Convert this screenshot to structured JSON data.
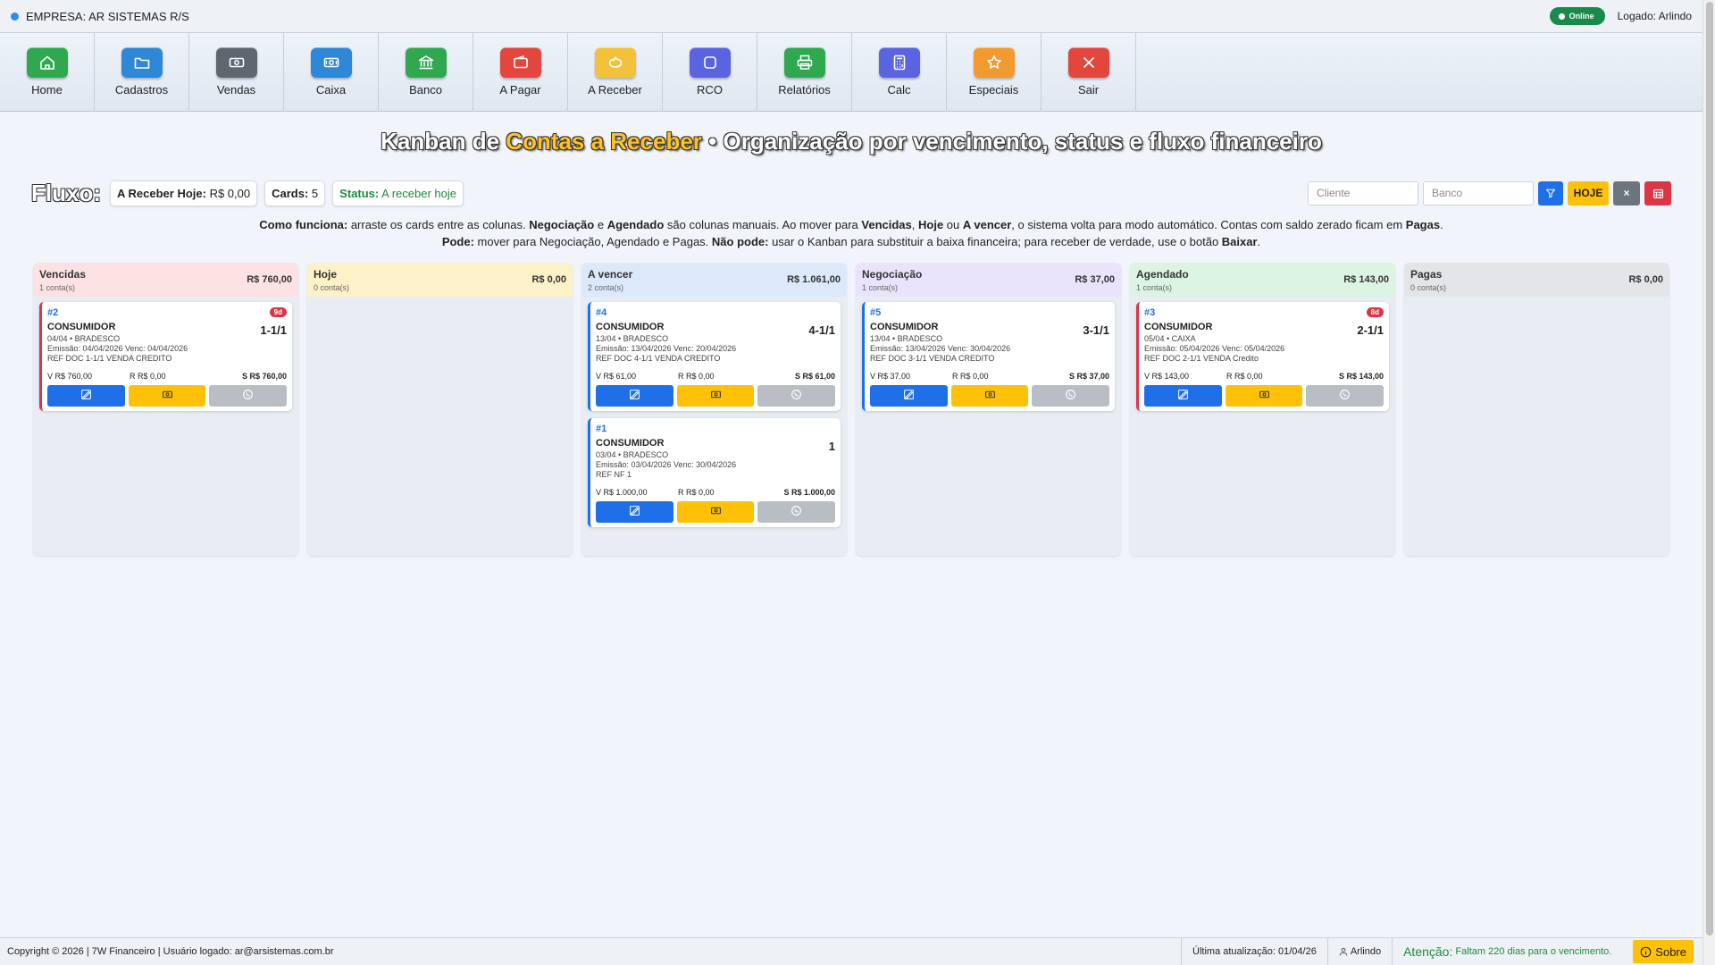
{
  "topbar": {
    "company": "EMPRESA: AR SISTEMAS R/S",
    "online": "Online",
    "logged": "Logado: Arlindo"
  },
  "toolbar": [
    {
      "label": "Home",
      "icon": "home-icon",
      "color": "#2fa84f"
    },
    {
      "label": "Cadastros",
      "icon": "folder-icon",
      "color": "#2f87d8"
    },
    {
      "label": "Vendas",
      "icon": "cash-icon",
      "color": "#5f6670"
    },
    {
      "label": "Caixa",
      "icon": "cash-register-icon",
      "color": "#2f87d8"
    },
    {
      "label": "Banco",
      "icon": "bank-icon",
      "color": "#2fa84f"
    },
    {
      "label": "A Pagar",
      "icon": "wallet-icon",
      "color": "#e2463c"
    },
    {
      "label": "A Receber",
      "icon": "piggy-icon",
      "color": "#f4c23a"
    },
    {
      "label": "RCO",
      "icon": "square-icon",
      "color": "#5a63e0"
    },
    {
      "label": "Relatórios",
      "icon": "printer-icon",
      "color": "#2fa84f"
    },
    {
      "label": "Calc",
      "icon": "calculator-icon",
      "color": "#5a63e0"
    },
    {
      "label": "Especiais",
      "icon": "star-icon",
      "color": "#f29a2e"
    },
    {
      "label": "Sair",
      "icon": "close-icon",
      "color": "#e2463c"
    }
  ],
  "heading": {
    "pre": "Kanban de ",
    "highlight": "Contas a Receber",
    "post": " • Organização por vencimento, status e fluxo financeiro"
  },
  "fluxo": {
    "title": "Fluxo:",
    "receber_hoje_label": "A Receber Hoje:",
    "receber_hoje_value": "R$ 0,00",
    "cards_label": "Cards:",
    "cards_value": "5",
    "status_label": "Status:",
    "status_value": "A receber hoje"
  },
  "filters": {
    "cliente_placeholder": "Cliente",
    "banco_placeholder": "Banco",
    "hoje": "HOJE",
    "clear": "×"
  },
  "info": {
    "line1": [
      {
        "t": "Como funciona:",
        "b": true
      },
      {
        "t": " arraste os cards entre as colunas. "
      },
      {
        "t": "Negociação",
        "b": true
      },
      {
        "t": " e "
      },
      {
        "t": "Agendado",
        "b": true
      },
      {
        "t": " são colunas manuais. Ao mover para "
      },
      {
        "t": "Vencidas",
        "b": true
      },
      {
        "t": ", "
      },
      {
        "t": "Hoje",
        "b": true
      },
      {
        "t": " ou "
      },
      {
        "t": "A vencer",
        "b": true
      },
      {
        "t": ", o sistema volta para modo automático. Contas com saldo zerado ficam em "
      },
      {
        "t": "Pagas",
        "b": true
      },
      {
        "t": "."
      }
    ],
    "line2": [
      {
        "t": "Pode:",
        "b": true
      },
      {
        "t": " mover para Negociação, Agendado e Pagas. "
      },
      {
        "t": "Não pode:",
        "b": true
      },
      {
        "t": " usar o Kanban para substituir a baixa financeira; para receber de verdade, use o botão "
      },
      {
        "t": "Baixar",
        "b": true
      },
      {
        "t": "."
      }
    ]
  },
  "columns": [
    {
      "title": "Vencidas",
      "count": "1 conta(s)",
      "total": "R$ 760,00",
      "color": "#fde2e4",
      "border": "#dc3545",
      "cards": [
        {
          "num": "#2",
          "days": "9d",
          "client": "CONSUMIDOR",
          "parcel": "1-1/1",
          "line1": "04/04 • BRADESCO",
          "line2": "Emissão: 04/04/2026 Venc: 04/04/2026",
          "line3": "REF DOC 1-1/1 VENDA CREDITO",
          "v": "V R$ 760,00",
          "r": "R R$ 0,00",
          "s": "S R$ 760,00"
        }
      ]
    },
    {
      "title": "Hoje",
      "count": "0 conta(s)",
      "total": "R$ 0,00",
      "color": "#fdf1c7",
      "border": "#ffc107",
      "cards": []
    },
    {
      "title": "A vencer",
      "count": "2 conta(s)",
      "total": "R$ 1.061,00",
      "color": "#dbe9fb",
      "border": "#1e6fe8",
      "cards": [
        {
          "num": "#4",
          "days": "",
          "client": "CONSUMIDOR",
          "parcel": "4-1/1",
          "line1": "13/04 • BRADESCO",
          "line2": "Emissão: 13/04/2026 Venc: 20/04/2026",
          "line3": "REF DOC 4-1/1 VENDA CREDITO",
          "v": "V R$ 61,00",
          "r": "R R$ 0,00",
          "s": "S R$ 61,00"
        },
        {
          "num": "#1",
          "days": "",
          "client": "CONSUMIDOR",
          "parcel": "1",
          "line1": "03/04 • BRADESCO",
          "line2": "Emissão: 03/04/2026 Venc: 30/04/2026",
          "line3": "REF NF 1",
          "v": "V R$ 1.000,00",
          "r": "R R$ 0,00",
          "s": "S R$ 1.000,00"
        }
      ]
    },
    {
      "title": "Negociação",
      "count": "1 conta(s)",
      "total": "R$ 37,00",
      "color": "#e9e4fb",
      "border": "#1e6fe8",
      "cards": [
        {
          "num": "#5",
          "days": "",
          "client": "CONSUMIDOR",
          "parcel": "3-1/1",
          "line1": "13/04 • BRADESCO",
          "line2": "Emissão: 13/04/2026 Venc: 30/04/2026",
          "line3": "REF DOC 3-1/1 VENDA CREDITO",
          "v": "V R$ 37,00",
          "r": "R R$ 0,00",
          "s": "S R$ 37,00"
        }
      ]
    },
    {
      "title": "Agendado",
      "count": "1 conta(s)",
      "total": "R$ 143,00",
      "color": "#dcf5e3",
      "border": "#dc3545",
      "cards": [
        {
          "num": "#3",
          "days": "8d",
          "client": "CONSUMIDOR",
          "parcel": "2-1/1",
          "line1": "05/04 • CAIXA",
          "line2": "Emissão: 05/04/2026 Venc: 05/04/2026",
          "line3": "REF DOC 2-1/1 VENDA Credito",
          "v": "V R$ 143,00",
          "r": "R R$ 0,00",
          "s": "S R$ 143,00"
        }
      ]
    },
    {
      "title": "Pagas",
      "count": "0 conta(s)",
      "total": "R$ 0,00",
      "color": "#e3e5e8",
      "border": "#6c757d",
      "cards": []
    }
  ],
  "footer": {
    "copyright": "Copyright © 2026 | 7W Financeiro | Usuário logado: ar@arsistemas.com.br",
    "update": "Última atualização: 01/04/26",
    "user": "Arlindo",
    "attention_label": "Atenção:",
    "attention_text": "Faltam 220 dias para o vencimento.",
    "sobre": "Sobre"
  }
}
